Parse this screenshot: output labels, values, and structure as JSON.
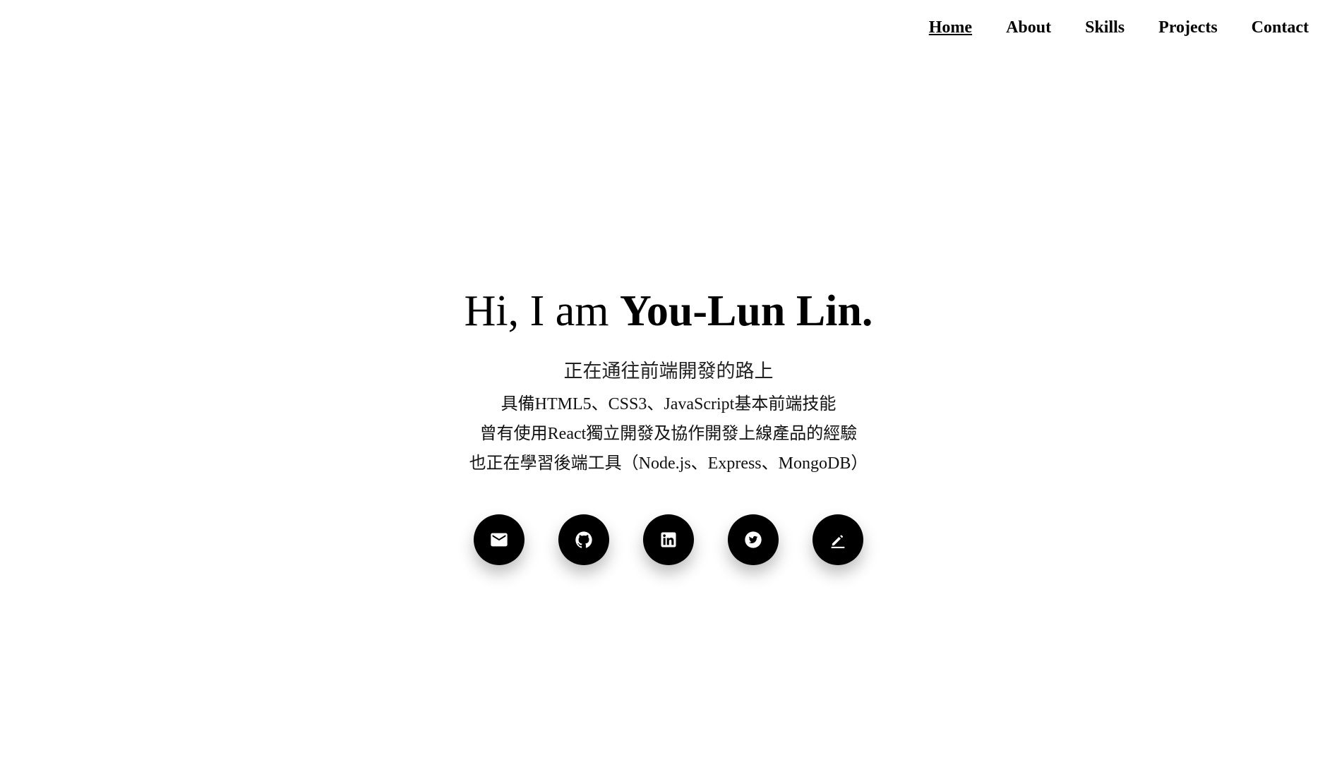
{
  "nav": {
    "items": [
      {
        "label": "Home",
        "active": true
      },
      {
        "label": "About",
        "active": false
      },
      {
        "label": "Skills",
        "active": false
      },
      {
        "label": "Projects",
        "active": false
      },
      {
        "label": "Contact",
        "active": false
      }
    ]
  },
  "hero": {
    "greeting": "Hi, I am ",
    "name": "You-Lun Lin.",
    "lead": "正在通往前端開發的路上",
    "lines": [
      "具備HTML5、CSS3、JavaScript基本前端技能",
      "曾有使用React獨立開發及協作開發上線產品的經驗",
      "也正在學習後端工具（Node.js、Express、MongoDB）"
    ]
  },
  "socials": [
    {
      "icon": "email-icon",
      "name": "email-button"
    },
    {
      "icon": "github-icon",
      "name": "github-button"
    },
    {
      "icon": "linkedin-icon",
      "name": "linkedin-button"
    },
    {
      "icon": "twitter-icon",
      "name": "twitter-button"
    },
    {
      "icon": "edit-icon",
      "name": "blog-button"
    }
  ],
  "colors": {
    "background": "#ffffff",
    "text": "#000000",
    "button": "#000000",
    "icon": "#ffffff"
  }
}
